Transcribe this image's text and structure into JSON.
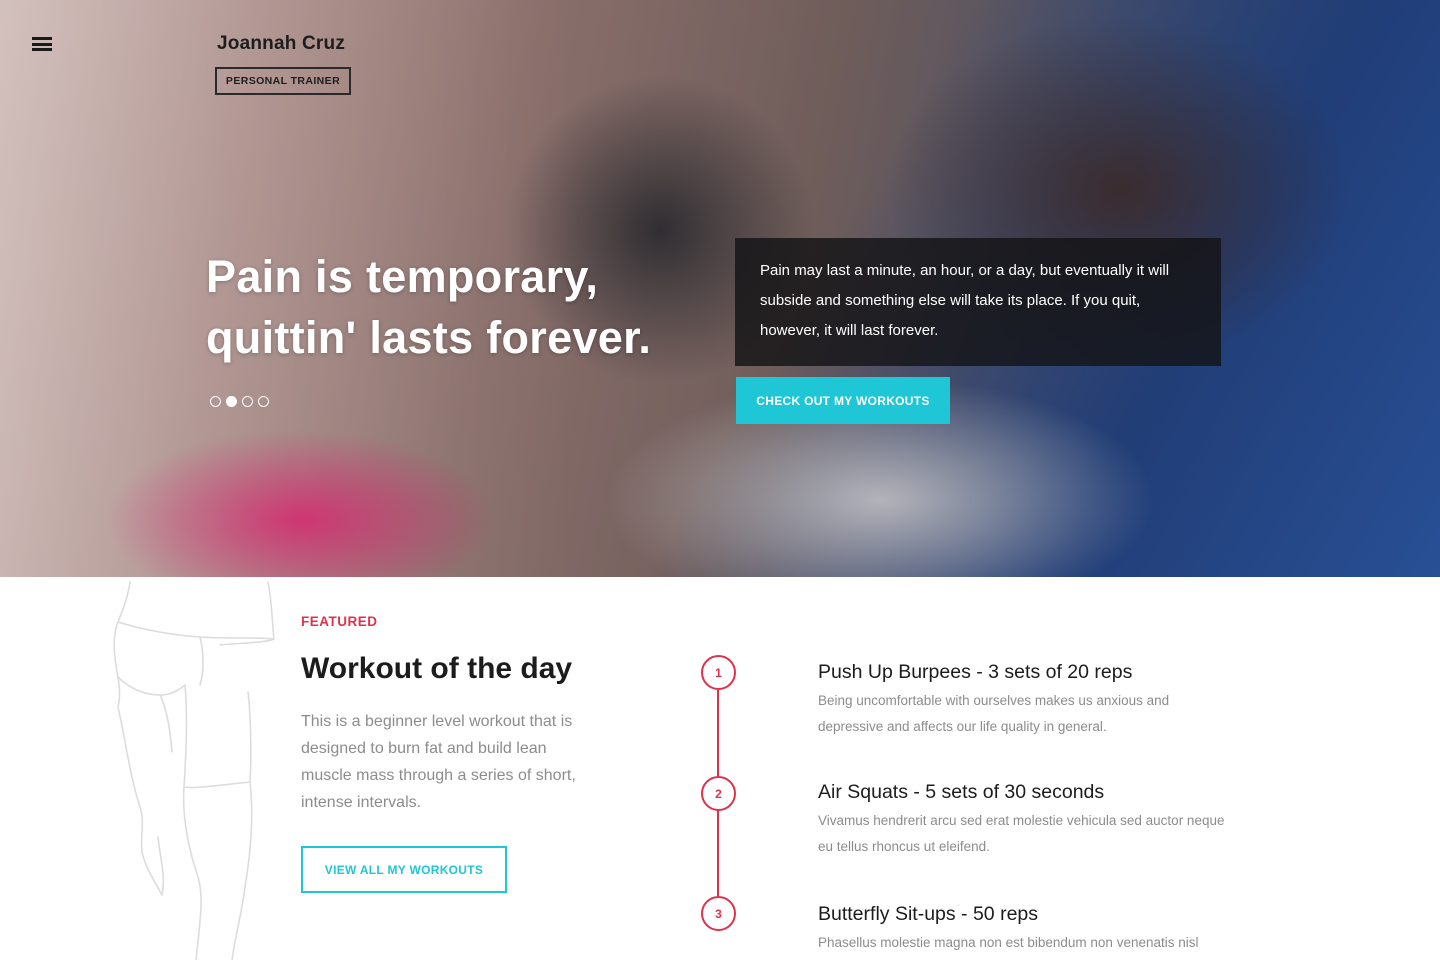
{
  "brand": {
    "name": "Joannah Cruz",
    "tagline": "PERSONAL TRAINER"
  },
  "hero": {
    "headline_line1": "Pain is temporary,",
    "headline_line2": "quittin' lasts forever.",
    "quote": "Pain may last a minute, an hour, or a day, but eventually it will subside and something else will take its place. If you quit, however, it will last forever.",
    "cta_label": "CHECK OUT MY WORKOUTS",
    "slides_total": 4,
    "slide_active": 2
  },
  "featured": {
    "eyebrow": "FEATURED",
    "title": "Workout of the day",
    "description": "This is a beginner level workout that is designed to burn fat and build lean muscle mass through a series of short, intense intervals.",
    "button_label": "VIEW ALL MY WORKOUTS"
  },
  "workouts": [
    {
      "number": "1",
      "title": "Push Up Burpees - 3 sets of 20 reps",
      "description": "Being uncomfortable with ourselves makes us anxious and depressive and affects our life quality in general."
    },
    {
      "number": "2",
      "title": "Air Squats - 5 sets of 30 seconds",
      "description": "Vivamus hendrerit arcu sed erat molestie vehicula sed auctor neque eu tellus rhoncus ut eleifend."
    },
    {
      "number": "3",
      "title": "Butterfly Sit-ups - 50 reps",
      "description": "Phasellus molestie magna non est bibendum non venenatis nisl"
    }
  ],
  "colors": {
    "accent_cyan": "#1fc6d6",
    "accent_red": "#e0314b",
    "text_dark": "#1c1c1c",
    "text_muted": "#8c8c8c"
  },
  "icons": {
    "menu": "hamburger-menu-icon"
  }
}
